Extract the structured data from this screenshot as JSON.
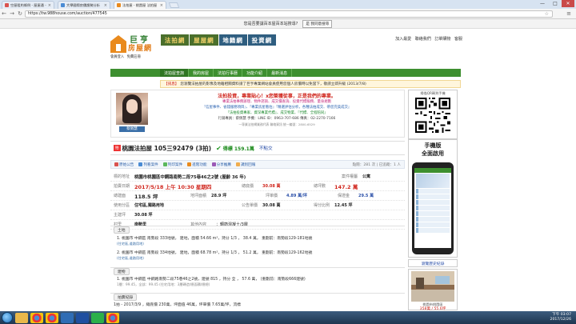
{
  "browser": {
    "tabs": [
      {
        "label": "空屋租約條例 - 屋屋通 -",
        "active": false,
        "favicon_color": "#d9534f"
      },
      {
        "label": "大學國際房價趨勢分析",
        "active": false,
        "favicon_color": "#4a8bd4"
      },
      {
        "label": "法拍屋 - 桃園屋 法拍屋",
        "active": true,
        "favicon_color": "#e98a1d"
      }
    ],
    "close_glyph": "×",
    "window_buttons": [
      "—",
      "□",
      "✕"
    ],
    "nav": {
      "back": "←",
      "forward": "→",
      "reload": "↻"
    },
    "url": "https://tw.988house.com/auction/477545",
    "star": "☆",
    "menu": "≡"
  },
  "notice": {
    "text": "您是否要讓百本屋百本站搜尋?",
    "button": "是 我同意搜尋"
  },
  "header": {
    "logo_line1": "巨亨",
    "logo_line2": "房屋網",
    "login_links": [
      "會員登入",
      "免費註冊"
    ],
    "banner": [
      "法拍網",
      "屋屋網",
      "地籍網",
      "投資網"
    ],
    "top_links": [
      "加入最愛",
      "聯絡我們",
      "訂單購物",
      "客服"
    ]
  },
  "navbar": {
    "items": [
      "法拍屋查詢",
      "我的房屋",
      "法拍行事曆",
      "功能介紹",
      "最新消息"
    ],
    "active_index": 0
  },
  "ticker": {
    "tag": "【訊息】",
    "text": "您瀏覽法拍屋的影像及地籍相關資料請了巨亨專業網站會員使用您個人房價時以免當下，敬請立即升級 (2013/7/8)"
  },
  "profile": {
    "name": "蔡佩慧",
    "lines": [
      "法拍投資，專業貼心！x您榮獲從事，正是我們的專業。",
      "專業法拍事務辦理、物件諮詢、成交價查詢、投資代標服務、量身規劃",
      "『信屋事件、省錢服務項目』、『專業房屋看估』『精選評估分析，各種法拍成交、帶您完美成交』",
      "『法拍投資專家、資深專業代標』、成交物業、『代標、全程陪同』",
      "行銷專員：蔡佩慧  手機：LINE ID：0963-707-686  傳真：02-2270-7166",
      "一專業法拍網業務代表 聯絡資訊 統一編號：2800-6529"
    ]
  },
  "listing": {
    "tag": "拍",
    "title": "桃園法拍屋 105三92479 (3拍)",
    "status": "得標 159.1萬",
    "status2": "不點交"
  },
  "toolbar": {
    "buttons": [
      {
        "label": "原始公告",
        "color": "#d9534f"
      },
      {
        "label": "列看案件",
        "color": "#4a8bd4"
      },
      {
        "label": "列印案件",
        "color": "#5cb85c"
      },
      {
        "label": "進階功能",
        "color": "#e98a1d"
      },
      {
        "label": "分享推薦",
        "color": "#9b59b6"
      },
      {
        "label": "識別回報",
        "color": "#f0ad4e"
      }
    ],
    "views": "點閱：281 次 | 已追蹤：1 人"
  },
  "details": {
    "address_label": "標的地址",
    "address": "桃園市桃園區中鋼路南勢二段75巷46之2號 (屋齡 36 年)",
    "owner_label": "案件權屬",
    "owner": "公寓",
    "auction_label": "拍賣日期",
    "auction_date": "2017/5/18 上午 10:30 星期四",
    "base_label": "總底價",
    "base_price": "30.08 萬",
    "total_label": "總坪數",
    "total_area": "147.2 萬",
    "building_label": "總建面",
    "building_area": "118.5 坪",
    "land_label": "地坪面積",
    "land_area": "28.9 坪",
    "unit_label": "坪單價",
    "unit_price": "4.89 萬/坪",
    "deposit_label": "保證金",
    "deposit": "29.5 萬",
    "use_label": "使用分區",
    "use": "住宅區,獨路用地",
    "market_label": "公告單價",
    "market": "30.08 萬",
    "bid_label": "得分比例",
    "bid": "12.45 坪",
    "bottom_label": "主建坪",
    "bottom": "30.08 坪",
    "village_label": "村里",
    "village": "南勢里",
    "other_label": "其他內容",
    "other": "：鋼筋混凝土/3層"
  },
  "land": {
    "heading": "土地",
    "items": [
      {
        "text": "1. 桃園市 中鋼區 南勢段 333地號， 建地，面積 54.66 m²，持分 1/3 ， 38.4 萬， 重劃前：南勢段129-181地號",
        "sub": "(住宅區,道路用地)"
      },
      {
        "text": "2. 桃園市 中鋼區 南勢段 334地號， 建地，面積 68.78 m²，持分 1/3 ， 51.2 萬， 重劃前：南勢段129-162地號",
        "sub": "(住宅區,道路用地)"
      }
    ]
  },
  "building": {
    "heading": "建物",
    "text": "1. 桃園市 中鋼區 中鋼路南勢二段75巷46之2號，建號 815 ，持分 全 ， 57.6 萬， (重劃前：南勢段666建號)",
    "sub": "1層：99.45，全部：99.45 (住宅用地：3層磚造/總面積/總總)"
  },
  "history": {
    "heading": "拍賣紀錄",
    "text": "1拍 - 2017/3/9 ，總底價 230萬，坪面值 46萬，坪單價 7.65萬/坪，流標"
  },
  "sidebar": {
    "qr_caption": "掃描QR碼到手機",
    "app_title_1": "手機版",
    "app_title_2": "全面啟用",
    "list_label": "瀏覽歷史紀錄",
    "photo_caption": "桃園市桃園區",
    "photo_price": "358萬 / 55.6坪"
  },
  "taskbar": {
    "time": "下午 03:07",
    "date": "2017/12/26",
    "icons": [
      "folder-icon",
      "chrome-icon",
      "chrome-icon",
      "media-icon",
      "word-icon",
      "line-icon",
      "chrome-icon"
    ]
  }
}
